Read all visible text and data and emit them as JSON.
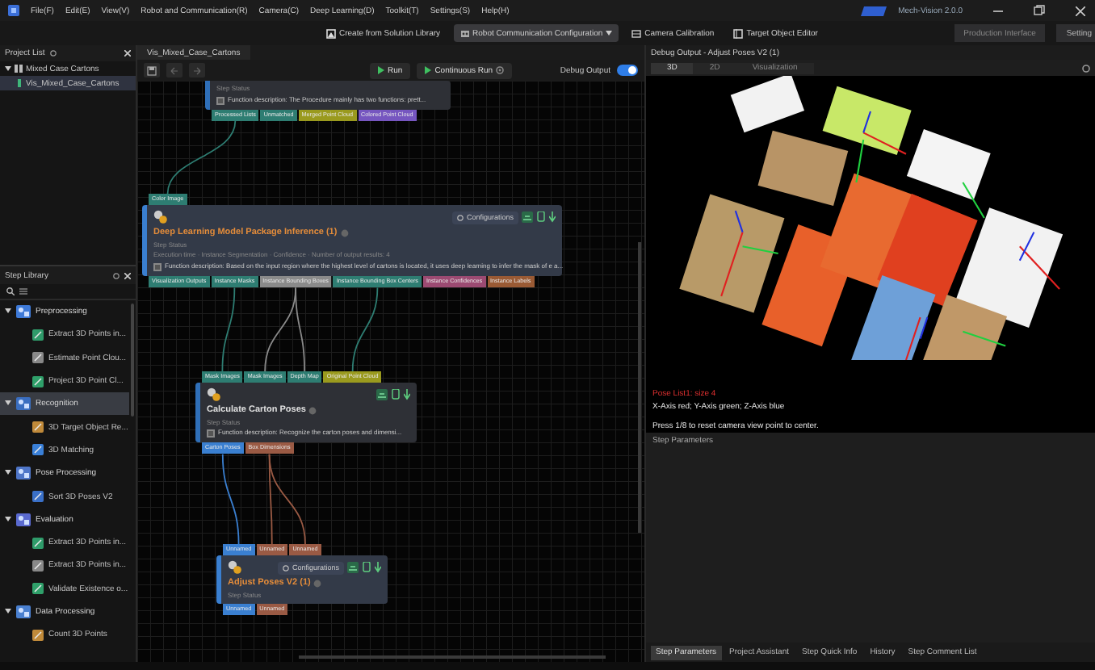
{
  "menu_bar": {
    "items": [
      "File(F)",
      "Edit(E)",
      "View(V)",
      "Robot and Communication(R)",
      "Camera(C)",
      "Deep Learning(D)",
      "Toolkit(T)",
      "Settings(S)",
      "Help(H)"
    ],
    "brand": "Mech-Vision 2.0.0"
  },
  "toolbar": {
    "buttons": [
      {
        "label": "Create from Solution Library",
        "selected": false
      },
      {
        "label": "Robot Communication Configuration",
        "selected": true
      },
      {
        "label": "Camera Calibration",
        "selected": false
      },
      {
        "label": "Target Object Editor",
        "selected": false
      }
    ],
    "right_buttons": [
      "Production Interface",
      "Setting"
    ]
  },
  "project_list": {
    "title": "Project List",
    "tree": [
      {
        "label": "Mixed Case Cartons",
        "expanded": true,
        "children": [
          {
            "label": "Vis_Mixed_Case_Cartons",
            "selected": true
          }
        ]
      }
    ]
  },
  "step_library": {
    "title": "Step Library",
    "categories": [
      {
        "label": "Preprocessing",
        "expanded": true,
        "selected": false,
        "children": [
          "Extract 3D Points in...",
          "Estimate Point Clou...",
          "Project 3D Point Cl..."
        ]
      },
      {
        "label": "Recognition",
        "expanded": true,
        "selected": true,
        "children": [
          "3D Target Object Re...",
          "3D Matching"
        ]
      },
      {
        "label": "Pose Processing",
        "expanded": true,
        "selected": false,
        "children": [
          "Sort 3D Poses V2"
        ]
      },
      {
        "label": "Evaluation",
        "expanded": true,
        "selected": false,
        "children": [
          "Extract 3D Points in...",
          "Extract 3D Points in...",
          "Validate Existence o..."
        ]
      },
      {
        "label": "Data Processing",
        "expanded": true,
        "selected": false,
        "children": [
          "Count 3D Points"
        ]
      }
    ]
  },
  "editor": {
    "tab": "Vis_Mixed_Case_Cartons",
    "run": "Run",
    "continuous_run": "Continuous Run",
    "debug_output": {
      "label": "Debug Output",
      "on": true
    }
  },
  "nodes": [
    {
      "status": "Step Status",
      "description": "Function description: The Procedure mainly has two functions: prett...",
      "description_checked": false,
      "outputs": [
        {
          "label": "Processed Lists",
          "color": "#2e7d72"
        },
        {
          "label": "Unmatched",
          "color": "#2e7d72"
        },
        {
          "label": "Merged Point Cloud",
          "color": "#9a9a1e"
        },
        {
          "label": "Colored Point Cloud",
          "color": "#7656c0"
        }
      ]
    },
    {
      "title": "Deep Learning Model Package Inference (1)",
      "status": "Step Status",
      "detail": "Execution time · Instance Segmentation · Confidence · Number of output results: 4",
      "configure": "Configurations",
      "description": "Function description: Based on the input region where the highest level of cartons is located, it uses deep learning to infer the mask of e a...",
      "description_checked": false,
      "inputs": [
        {
          "label": "Color Image",
          "color": "#2e7d72"
        }
      ],
      "outputs": [
        {
          "label": "Visualization Outputs",
          "color": "#2e7d72"
        },
        {
          "label": "Instance Masks",
          "color": "#2e7d72"
        },
        {
          "label": "Instance Bounding Boxes",
          "color": "#8a8a8a"
        },
        {
          "label": "Instance Bounding Box Centers",
          "color": "#2e7d72"
        },
        {
          "label": "Instance Confidences",
          "color": "#9c4a72"
        },
        {
          "label": "Instance Labels",
          "color": "#9a5a34"
        }
      ]
    },
    {
      "title": "Calculate Carton Poses",
      "status": "Step Status",
      "description": "Function description: Recognize the carton poses and dimensi...",
      "description_checked": false,
      "inputs": [
        {
          "label": "Mask Images",
          "color": "#2e7d72"
        },
        {
          "label": "Mask Images",
          "color": "#2e7d72"
        },
        {
          "label": "Depth Map",
          "color": "#2e7d72"
        },
        {
          "label": "Original Point Cloud",
          "color": "#9a9a1e"
        }
      ],
      "outputs": [
        {
          "label": "Carton Poses",
          "color": "#3a7fd0"
        },
        {
          "label": "Box Dimensions",
          "color": "#9a5a44"
        }
      ]
    },
    {
      "title": "Adjust Poses V2 (1)",
      "status": "Step Status",
      "configure": "Configurations",
      "inputs": [
        {
          "label": "Unnamed",
          "color": "#3a7fd0"
        },
        {
          "label": "Unnamed",
          "color": "#9a5a44"
        },
        {
          "label": "Unnamed",
          "color": "#9a5a44"
        }
      ],
      "outputs": [
        {
          "label": "Unnamed",
          "color": "#3a7fd0"
        },
        {
          "label": "Unnamed",
          "color": "#9a5a44"
        }
      ]
    }
  ],
  "debug_output": {
    "title": "Debug Output - Adjust Poses V2 (1)",
    "tabs": [
      {
        "label": "3D",
        "selected": true
      },
      {
        "label": "2D",
        "selected": false
      },
      {
        "label": "Visualization",
        "selected": false
      }
    ],
    "pose_list": "Pose List1: size 4",
    "axes_legend": "X-Axis red; Y-Axis green; Z-Axis blue",
    "hint": "Press 1/8 to reset camera view point to center.",
    "parameters_title": "Step Parameters"
  },
  "bottom_tabs": [
    {
      "label": "Step Parameters",
      "selected": true
    },
    {
      "label": "Project Assistant",
      "selected": false
    },
    {
      "label": "Step Quick Info",
      "selected": false
    },
    {
      "label": "History",
      "selected": false
    },
    {
      "label": "Step Comment List",
      "selected": false
    }
  ]
}
